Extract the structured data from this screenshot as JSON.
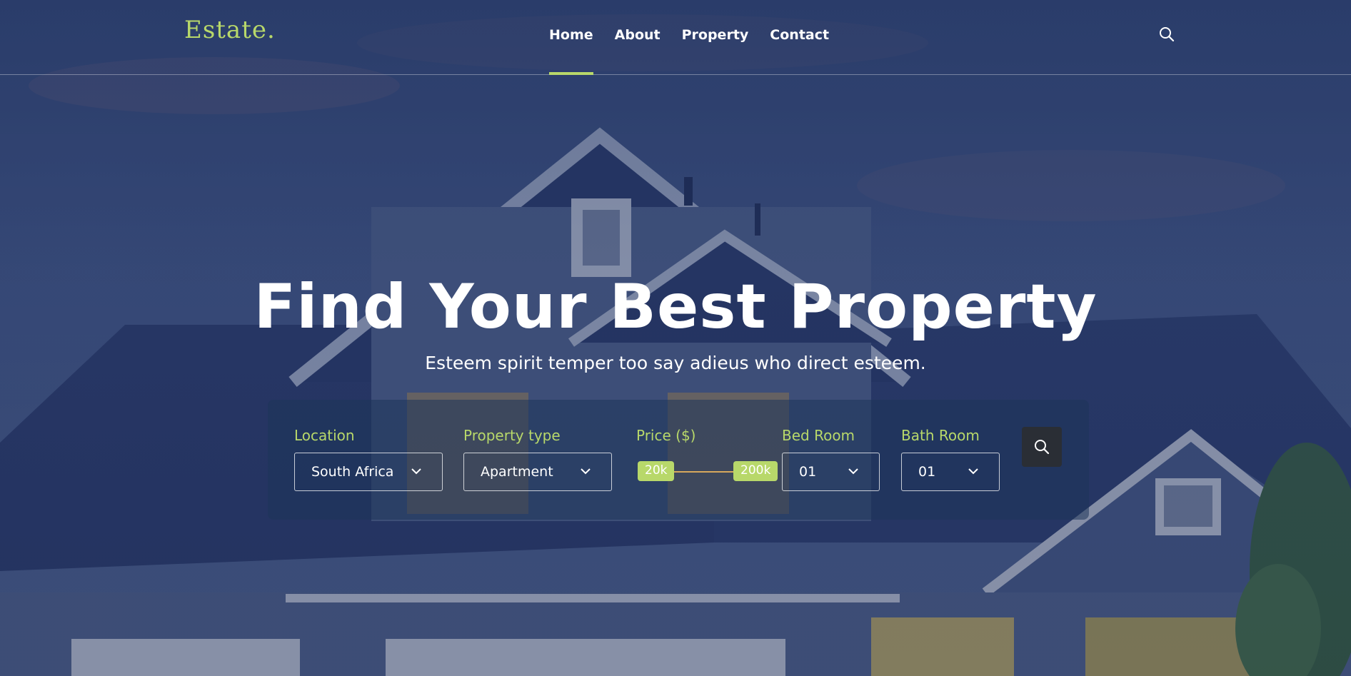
{
  "brand": {
    "logo_text": "Estate.",
    "accent_color": "#b8d86a"
  },
  "nav": {
    "items": [
      {
        "label": "Home",
        "active": true
      },
      {
        "label": "About",
        "active": false
      },
      {
        "label": "Property",
        "active": false
      },
      {
        "label": "Contact",
        "active": false
      }
    ],
    "search_icon": "search-icon"
  },
  "hero": {
    "title": "Find Your Best Property",
    "subtitle": "Esteem spirit temper too say adieus who direct esteem."
  },
  "search_form": {
    "location": {
      "label": "Location",
      "value": "South Africa"
    },
    "property_type": {
      "label": "Property type",
      "value": "Apartment"
    },
    "price": {
      "label": "Price ($)",
      "min": "20k",
      "max": "200k"
    },
    "bed_room": {
      "label": "Bed Room",
      "value": "01"
    },
    "bath_room": {
      "label": "Bath Room",
      "value": "01"
    },
    "submit_icon": "search-icon"
  }
}
